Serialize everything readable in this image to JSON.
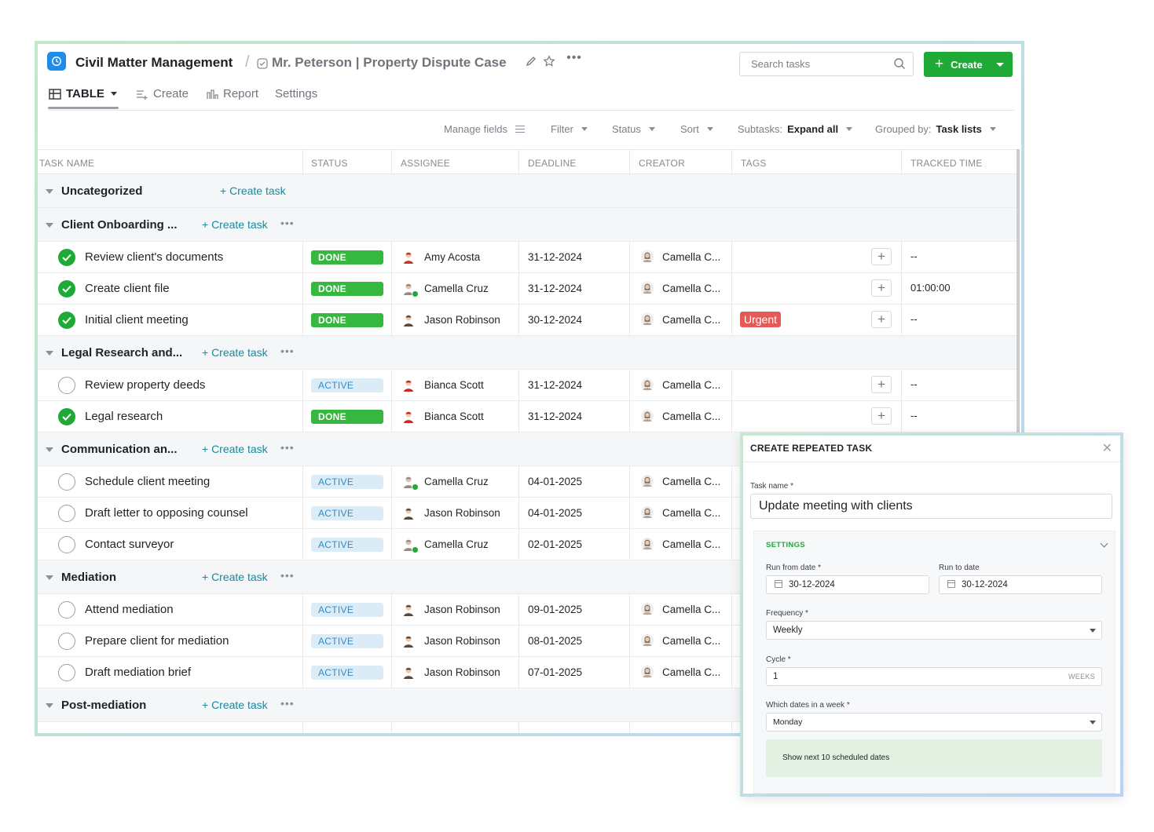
{
  "header": {
    "app_title": "Civil Matter Management",
    "separator": "/",
    "list_title": "Mr. Peterson | Property Dispute Case",
    "search_placeholder": "Search tasks",
    "create_label": "Create"
  },
  "tabs": [
    {
      "label": "TABLE",
      "icon": "table-icon"
    },
    {
      "label": "Create",
      "icon": "form-icon"
    },
    {
      "label": "Report",
      "icon": "chart-icon"
    },
    {
      "label": "Settings",
      "icon": ""
    }
  ],
  "toolbar": {
    "manage_fields": "Manage fields",
    "filter": "Filter",
    "status": "Status",
    "sort": "Sort",
    "subtasks_label": "Subtasks:",
    "subtasks_value": "Expand all",
    "grouped_label": "Grouped by:",
    "grouped_value": "Task lists"
  },
  "columns": [
    "TASK NAME",
    "STATUS",
    "ASSIGNEE",
    "DEADLINE",
    "CREATOR",
    "TAGS",
    "TRACKED TIME"
  ],
  "create_task_label": "+ Create task",
  "groups": [
    {
      "name": "Uncategorized",
      "tasks": []
    },
    {
      "name": "Client Onboarding ...",
      "tasks": [
        {
          "name": "Review client's documents",
          "status": "DONE",
          "assignee": "Amy Acosta",
          "deadline": "31-12-2024",
          "creator": "Camella C...",
          "tag": "",
          "tracked": "--"
        },
        {
          "name": "Create client file",
          "status": "DONE",
          "assignee": "Camella Cruz",
          "deadline": "31-12-2024",
          "creator": "Camella C...",
          "tag": "",
          "tracked": "01:00:00"
        },
        {
          "name": "Initial client meeting",
          "status": "DONE",
          "assignee": "Jason Robinson",
          "deadline": "30-12-2024",
          "creator": "Camella C...",
          "tag": "Urgent",
          "tracked": "--"
        }
      ]
    },
    {
      "name": "Legal Research and...",
      "tasks": [
        {
          "name": "Review property deeds",
          "status": "ACTIVE",
          "assignee": "Bianca Scott",
          "deadline": "31-12-2024",
          "creator": "Camella C...",
          "tag": "",
          "tracked": "--"
        },
        {
          "name": "Legal research",
          "status": "DONE",
          "assignee": "Bianca Scott",
          "deadline": "31-12-2024",
          "creator": "Camella C...",
          "tag": "",
          "tracked": "--"
        }
      ]
    },
    {
      "name": "Communication an...",
      "tasks": [
        {
          "name": "Schedule client meeting",
          "status": "ACTIVE",
          "assignee": "Camella Cruz",
          "deadline": "04-01-2025",
          "creator": "Camella C...",
          "tag": "",
          "tracked": ""
        },
        {
          "name": "Draft letter to opposing counsel",
          "status": "ACTIVE",
          "assignee": "Jason Robinson",
          "deadline": "04-01-2025",
          "creator": "Camella C...",
          "tag": "",
          "tracked": ""
        },
        {
          "name": "Contact surveyor",
          "status": "ACTIVE",
          "assignee": "Camella Cruz",
          "deadline": "02-01-2025",
          "creator": "Camella C...",
          "tag": "",
          "tracked": ""
        }
      ]
    },
    {
      "name": "Mediation",
      "tasks": [
        {
          "name": "Attend mediation",
          "status": "ACTIVE",
          "assignee": "Jason Robinson",
          "deadline": "09-01-2025",
          "creator": "Camella C...",
          "tag": "",
          "tracked": ""
        },
        {
          "name": "Prepare client for mediation",
          "status": "ACTIVE",
          "assignee": "Jason Robinson",
          "deadline": "08-01-2025",
          "creator": "Camella C...",
          "tag": "",
          "tracked": ""
        },
        {
          "name": "Draft mediation brief",
          "status": "ACTIVE",
          "assignee": "Jason Robinson",
          "deadline": "07-01-2025",
          "creator": "Camella C...",
          "tag": "",
          "tracked": ""
        }
      ]
    },
    {
      "name": "Post-mediation",
      "tasks": []
    }
  ],
  "modal": {
    "title": "CREATE REPEATED TASK",
    "task_name_label": "Task name *",
    "task_name_value": "Update meeting with clients",
    "settings_heading": "SETTINGS",
    "run_from_label": "Run from date *",
    "run_from_value": "30-12-2024",
    "run_to_label": "Run to date",
    "run_to_value": "30-12-2024",
    "frequency_label": "Frequency *",
    "frequency_value": "Weekly",
    "cycle_label": "Cycle *",
    "cycle_value": "1",
    "cycle_unit": "WEEKS",
    "dates_label": "Which dates in a week *",
    "dates_value": "Monday",
    "preview_label": "Show next 10 scheduled dates"
  }
}
